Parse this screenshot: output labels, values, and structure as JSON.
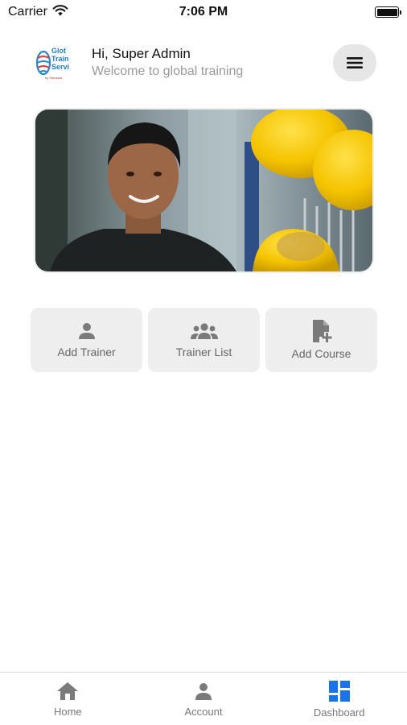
{
  "status_bar": {
    "carrier": "Carrier",
    "time": "7:06 PM"
  },
  "header": {
    "logo_text": [
      "Glot",
      "Train",
      "Servi"
    ],
    "logo_tag": "by Samasta",
    "greeting": "Hi, Super Admin",
    "subtitle": "Welcome to global training",
    "menu_icon": "hamburger-icon"
  },
  "banner": {
    "image": "worker-with-yellow-hardhats-photo"
  },
  "actions": [
    {
      "label": "Add Trainer",
      "icon": "person-icon"
    },
    {
      "label": "Trainer List",
      "icon": "group-icon"
    },
    {
      "label": "Add Course",
      "icon": "add-document-icon"
    }
  ],
  "bottom_nav": {
    "items": [
      {
        "label": "Home",
        "icon": "home-icon"
      },
      {
        "label": "Account",
        "icon": "person-icon"
      },
      {
        "label": "Dashboard",
        "icon": "dashboard-icon"
      }
    ],
    "active": "Dashboard",
    "colors": {
      "active_icon": "#1a73e8",
      "inactive_icon": "#7a7a7a"
    }
  }
}
